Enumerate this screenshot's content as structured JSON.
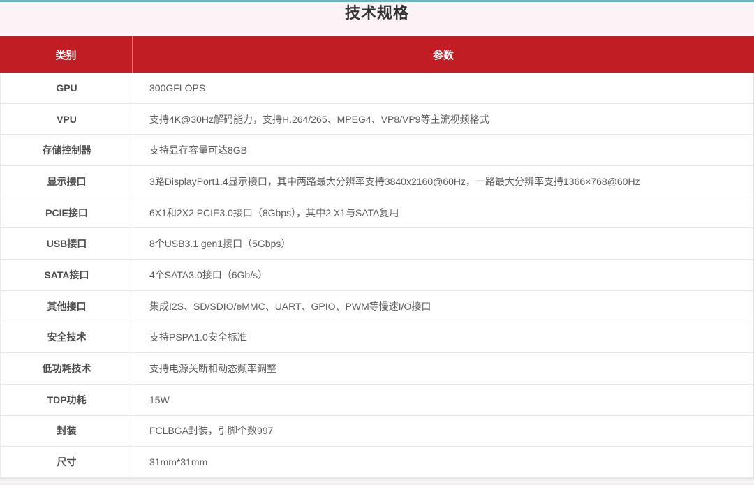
{
  "page": {
    "title": "技术规格",
    "accent_teal": "#72b4ba",
    "header_background": "#fdf2f6",
    "brand_red": "#c01e24"
  },
  "table": {
    "columns": [
      {
        "label": "类别"
      },
      {
        "label": "参数"
      }
    ],
    "rows": [
      {
        "category": "GPU",
        "value": "300GFLOPS"
      },
      {
        "category": "VPU",
        "value": "支持4K@30Hz解码能力，支持H.264/265、MPEG4、VP8/VP9等主流视频格式"
      },
      {
        "category": "存储控制器",
        "value": "支持显存容量可达8GB"
      },
      {
        "category": "显示接口",
        "value": "3路DisplayPort1.4显示接口，其中两路最大分辨率支持3840x2160@60Hz，一路最大分辨率支持1366×768@60Hz"
      },
      {
        "category": "PCIE接口",
        "value": "6X1和2X2 PCIE3.0接口（8Gbps），其中2 X1与SATA复用"
      },
      {
        "category": "USB接口",
        "value": "8个USB3.1 gen1接口（5Gbps）"
      },
      {
        "category": "SATA接口",
        "value": "4个SATA3.0接口（6Gb/s）"
      },
      {
        "category": "其他接口",
        "value": "集成I2S、SD/SDIO/eMMC、UART、GPIO、PWM等慢速I/O接口"
      },
      {
        "category": "安全技术",
        "value": "支持PSPA1.0安全标准"
      },
      {
        "category": "低功耗技术",
        "value": "支持电源关断和动态频率调整"
      },
      {
        "category": "TDP功耗",
        "value": "15W"
      },
      {
        "category": "封装",
        "value": "FCLBGA封装，引脚个数997"
      },
      {
        "category": "尺寸",
        "value": "31mm*31mm"
      }
    ]
  }
}
